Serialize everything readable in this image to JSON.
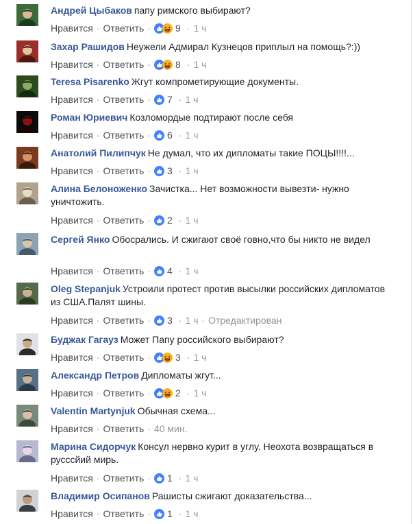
{
  "actions": {
    "like": "Нравится",
    "reply": "Ответить",
    "dot": "·"
  },
  "colors": {
    "author": "#385898",
    "meta": "#90949c",
    "like_blue": "#4080ff",
    "haha_yellow": "#f7b125"
  },
  "comments": [
    {
      "author": "Андрей Цыбаков",
      "text": "папу римского выбирают?",
      "reactions": [
        "like-icon",
        "haha-icon"
      ],
      "count": "9",
      "time": "1 ч",
      "edited": ""
    },
    {
      "author": "Захар Рашидов",
      "text": "Неужели Адмирал Кузнецов приплыл на помощь?:))",
      "reactions": [
        "like-icon",
        "haha-icon"
      ],
      "count": "8",
      "time": "1 ч",
      "edited": ""
    },
    {
      "author": "Teresa Pisarenko",
      "text": "Жгут компрометирующие документы.",
      "reactions": [
        "like-icon"
      ],
      "count": "7",
      "time": "1 ч",
      "edited": ""
    },
    {
      "author": "Роман Юриевич",
      "text": "Козломордые подтирают после себя",
      "reactions": [
        "like-icon"
      ],
      "count": "6",
      "time": "1 ч",
      "edited": ""
    },
    {
      "author": "Анатолий Пилипчук",
      "text": "Не думал, что их дипломаты такие ПОЦЫ!!!!...",
      "reactions": [
        "like-icon"
      ],
      "count": "3",
      "time": "1 ч",
      "edited": ""
    },
    {
      "author": "Алина Белоноженко",
      "text": "Зачистка... Нет возможности вывезти- нужно уничтожить.",
      "reactions": [
        "like-icon"
      ],
      "count": "2",
      "time": "1 ч",
      "edited": ""
    },
    {
      "author": "Сергей Янко",
      "text": "Обосрались. И сжигают своё говно,что бы никто не видел",
      "reactions": [
        "like-icon"
      ],
      "count": "4",
      "time": "1 ч",
      "edited": ""
    },
    {
      "author": "Oleg Stepanjuk",
      "text": "Устроили протест против высылки российских дипломатов из США.Палят шины.",
      "reactions": [
        "like-icon"
      ],
      "count": "3",
      "time": "1 ч",
      "edited": "Отредактирован"
    },
    {
      "author": "Буджак Гагауз",
      "text": "Может Папу российского выбирают?",
      "reactions": [
        "like-icon",
        "haha-icon"
      ],
      "count": "3",
      "time": "1 ч",
      "edited": ""
    },
    {
      "author": "Александр Петров",
      "text": "Дипломаты жгут...",
      "reactions": [
        "like-icon",
        "haha-icon"
      ],
      "count": "2",
      "time": "1 ч",
      "edited": ""
    },
    {
      "author": "Valentin Martynjuk",
      "text": "Обычная схема...",
      "reactions": [],
      "count": "",
      "time": "40 мин.",
      "edited": ""
    },
    {
      "author": "Марина Сидорчук",
      "text": "Консул нервно курит в углу. Неохота возвращаться в русссйий мирь.",
      "reactions": [
        "like-icon"
      ],
      "count": "1",
      "time": "1 ч",
      "edited": ""
    },
    {
      "author": "Владимир Осипанов",
      "text": "Рашисты сжигают доказательства...",
      "reactions": [
        "like-icon"
      ],
      "count": "1",
      "time": "1 ч",
      "edited": ""
    }
  ]
}
